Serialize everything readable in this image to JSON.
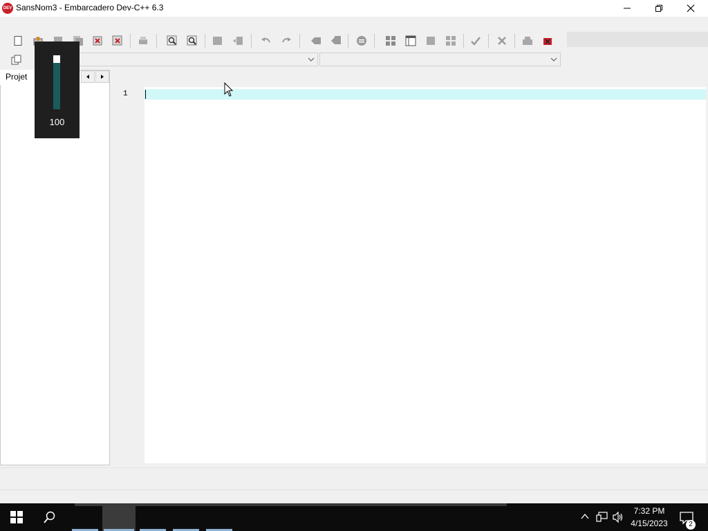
{
  "window": {
    "title": "SansNom3 - Embarcadero Dev-C++ 6.3",
    "app_icon_text": "DEV"
  },
  "left_panel": {
    "tab_label": "Projet"
  },
  "editor": {
    "line_numbers": [
      "1"
    ],
    "current_line_color": "#d0f8f8"
  },
  "volume_popup": {
    "value": "100",
    "level_percent": 100
  },
  "taskbar": {
    "time": "7:32 PM",
    "date": "4/15/2023",
    "notification_count": "2"
  },
  "colors": {
    "accent_red": "#c8202a",
    "volume_track": "#1c5b5b",
    "taskbar_bg": "#0c0c0c"
  }
}
